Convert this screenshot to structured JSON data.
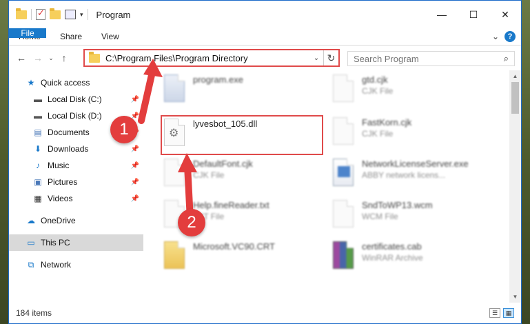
{
  "window": {
    "title": "Program",
    "controls": {
      "minimize": "—",
      "maximize": "☐",
      "close": "✕"
    }
  },
  "ribbon": {
    "tabs": [
      "File",
      "Home",
      "Share",
      "View"
    ],
    "expand": "⌄",
    "help": "?"
  },
  "address": {
    "path": "C:\\Program Files\\Program Directory",
    "refresh": "↻",
    "back": "←",
    "forward": "→",
    "dropdown": "⌄",
    "up": "↑"
  },
  "search": {
    "placeholder": "Search Program"
  },
  "nav": {
    "items": [
      {
        "label": "Quick access",
        "icon": "star-icon"
      },
      {
        "label": "Local Disk (C:)",
        "icon": "drive-icon"
      },
      {
        "label": "Local Disk (D:)",
        "icon": "drive-icon"
      },
      {
        "label": "Documents",
        "icon": "documents-icon"
      },
      {
        "label": "Downloads",
        "icon": "download-icon"
      },
      {
        "label": "Music",
        "icon": "music-icon"
      },
      {
        "label": "Pictures",
        "icon": "pictures-icon"
      },
      {
        "label": "Videos",
        "icon": "videos-icon"
      },
      {
        "label": "OneDrive",
        "icon": "cloud-icon"
      },
      {
        "label": "This PC",
        "icon": "computer-icon"
      },
      {
        "label": "Network",
        "icon": "network-icon"
      }
    ]
  },
  "files": [
    {
      "name": "program.exe",
      "type": ""
    },
    {
      "name": "gtd.cjk",
      "type": "CJK File"
    },
    {
      "name": "lyvesbot_105.dll",
      "type": ""
    },
    {
      "name": "FastKorn.cjk",
      "type": "CJK File"
    },
    {
      "name": "DefaultFont.cjk",
      "type": "CJK File"
    },
    {
      "name": "NetworkLicenseServer.exe",
      "type": "ABBY network licens..."
    },
    {
      "name": "Help.fineReader.txt",
      "type": "TXT File"
    },
    {
      "name": "SndToWP13.wcm",
      "type": "WCM File"
    },
    {
      "name": "Microsoft.VC90.CRT",
      "type": ""
    },
    {
      "name": "certificates.cab",
      "type": "WinRAR Archive"
    }
  ],
  "status": {
    "count": "184 items"
  },
  "annotations": {
    "step1": "1",
    "step2": "2"
  },
  "colors": {
    "accent": "#1979ca",
    "highlight": "#e04a4a",
    "badge": "#e33d3d"
  }
}
